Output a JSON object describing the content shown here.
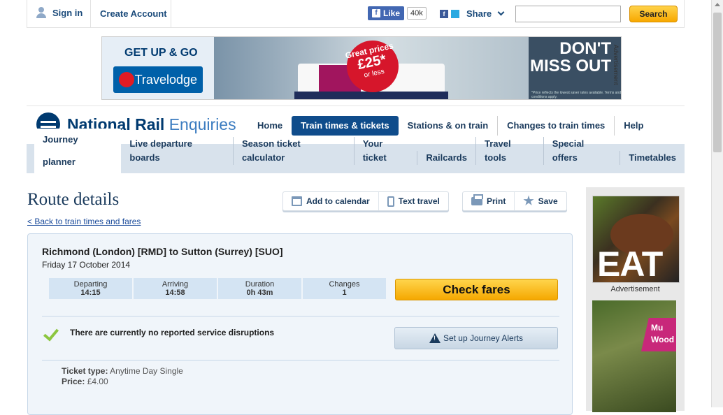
{
  "topbar": {
    "signin_label": "Sign in",
    "create_account_label": "Create Account",
    "fb_like_label": "Like",
    "fb_like_count": "40k",
    "share_label": "Share",
    "search_placeholder": "",
    "search_button_label": "Search"
  },
  "banner_ad": {
    "headline": "GET UP & GO",
    "brand": "Travelodge",
    "price_line1": "Great prices",
    "price": "£25*",
    "price_suffix": "or less",
    "cta": "DON'T MISS OUT",
    "fineprint": "*Price reflects the lowest saver rates available. Terms and conditions apply.",
    "side_label": "Advertisement"
  },
  "logo": {
    "brand_bold": "National Rail",
    "brand_light": "Enquiries"
  },
  "main_nav": [
    {
      "label": "Home",
      "active": false
    },
    {
      "label": "Train times & tickets",
      "active": true
    },
    {
      "label": "Stations & on train",
      "active": false
    },
    {
      "label": "Changes to train times",
      "active": false
    },
    {
      "label": "Help",
      "active": false
    }
  ],
  "sub_nav": [
    {
      "label": "Journey planner",
      "active": true
    },
    {
      "label": "Live departure boards",
      "active": false
    },
    {
      "label": "Season ticket calculator",
      "active": false
    },
    {
      "label": "Your ticket",
      "active": false
    },
    {
      "label": "Railcards",
      "active": false
    },
    {
      "label": "Travel tools",
      "active": false
    },
    {
      "label": "Special offers",
      "active": false
    },
    {
      "label": "Timetables",
      "active": false
    }
  ],
  "page": {
    "title": "Route details",
    "back_link": "< Back to train times and fares"
  },
  "toolbar": {
    "add_calendar": "Add to calendar",
    "text_travel": "Text travel",
    "print": "Print",
    "save": "Save"
  },
  "journey": {
    "route": "Richmond (London) [RMD] to Sutton (Surrey) [SUO]",
    "date": "Friday 17 October 2014",
    "stats": [
      {
        "label": "Departing",
        "value": "14:15"
      },
      {
        "label": "Arriving",
        "value": "14:58"
      },
      {
        "label": "Duration",
        "value": "0h 43m"
      },
      {
        "label": "Changes",
        "value": "1"
      }
    ],
    "check_fares_label": "Check fares",
    "disruption_text": "There are currently no reported service disruptions",
    "alerts_label": "Set up Journey Alerts",
    "ticket_type_label": "Ticket type:",
    "ticket_type_value": "Anytime Day Single",
    "price_label": "Price:",
    "price_value": "£4.00"
  },
  "right_ads": {
    "ad1_text": "EAT",
    "ad_label": "Advertisement",
    "ad2_text": "Mu Wood"
  },
  "colors": {
    "brand_navy": "#003a70",
    "nav_active": "#0f4c8b",
    "cta_yellow": "#f5a800",
    "ok_green": "#8cc63f"
  }
}
